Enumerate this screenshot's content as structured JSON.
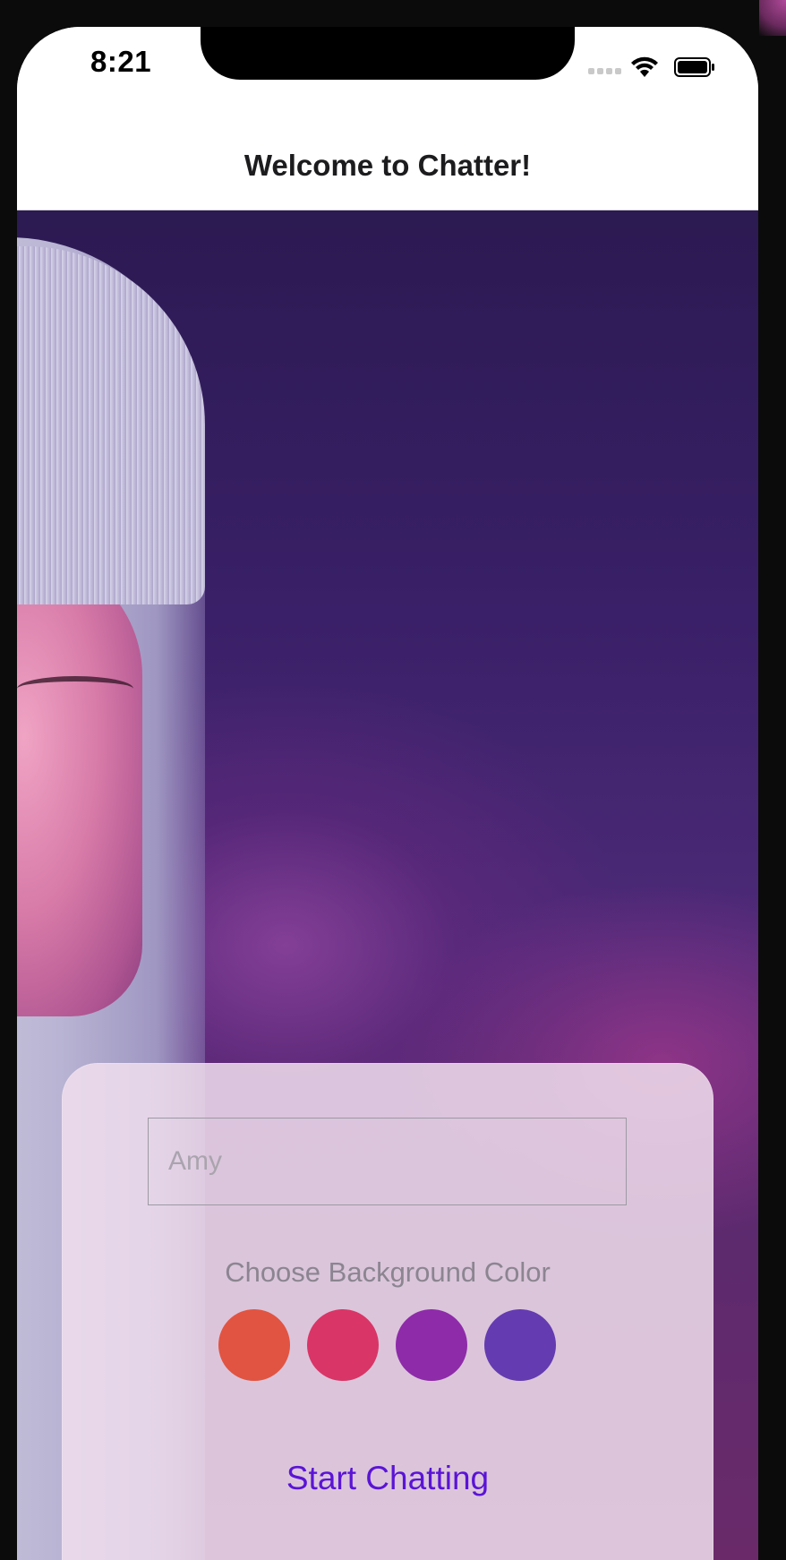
{
  "status_bar": {
    "time": "8:21"
  },
  "nav": {
    "title": "Welcome to Chatter!"
  },
  "form": {
    "name_placeholder": "Amy",
    "color_label": "Choose Background Color",
    "colors": [
      {
        "name": "orange-red",
        "hex": "#E15441"
      },
      {
        "name": "crimson",
        "hex": "#D93566"
      },
      {
        "name": "purple",
        "hex": "#8E2BA9"
      },
      {
        "name": "indigo",
        "hex": "#643BB0"
      }
    ],
    "start_label": "Start Chatting"
  },
  "colors": {
    "accent": "#5A14D6",
    "card_bg": "#F0DEEE"
  }
}
